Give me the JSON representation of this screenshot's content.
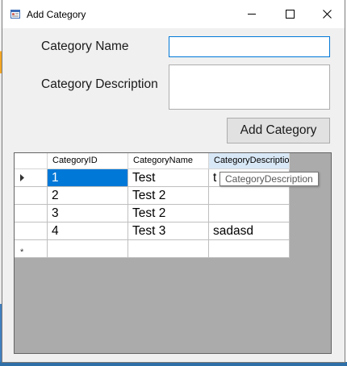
{
  "window": {
    "title": "Add Category",
    "controls": {
      "minimize": "minimize-icon",
      "maximize": "maximize-icon",
      "close": "close-icon"
    }
  },
  "form": {
    "name_label": "Category Name",
    "name_value": "",
    "description_label": "Category Description",
    "description_value": "",
    "submit_label": "Add Category"
  },
  "grid": {
    "columns": [
      "CategoryID",
      "CategoryName",
      "CategoryDescriptio"
    ],
    "rows": [
      {
        "id": "1",
        "name": "Test",
        "description": "t",
        "current": true
      },
      {
        "id": "2",
        "name": "Test 2",
        "description": ""
      },
      {
        "id": "3",
        "name": "Test 2",
        "description": ""
      },
      {
        "id": "4",
        "name": "Test 3",
        "description": "sadasd"
      }
    ],
    "new_row_marker": "*",
    "tooltip": "CategoryDescription"
  },
  "colors": {
    "selection": "#0078d7",
    "focus_border": "#0078d7",
    "grid_background": "#ababab",
    "header_active": "#d9e8f6"
  }
}
